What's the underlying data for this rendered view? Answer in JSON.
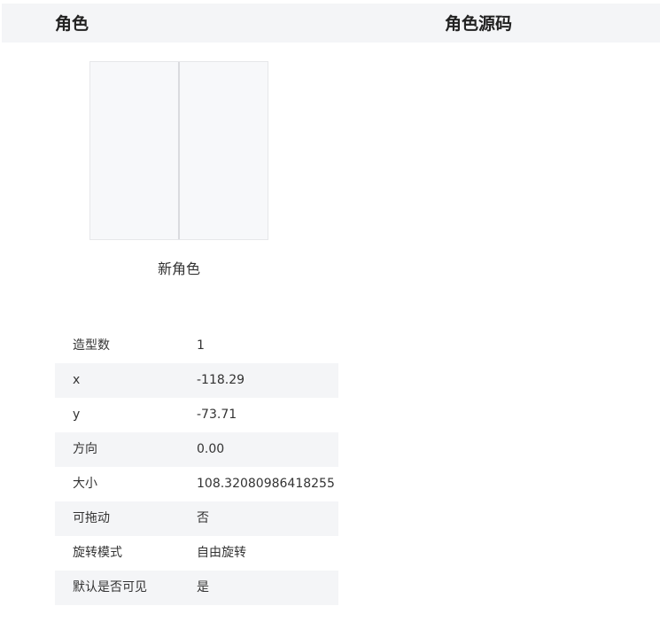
{
  "header": {
    "left_title": "角色",
    "right_title": "角色源码"
  },
  "sprite": {
    "name": "新角色"
  },
  "properties": [
    {
      "key": "造型数",
      "value": "1"
    },
    {
      "key": "x",
      "value": "-118.29"
    },
    {
      "key": "y",
      "value": "-73.71"
    },
    {
      "key": "方向",
      "value": "0.00"
    },
    {
      "key": "大小",
      "value": "108.32080986418255"
    },
    {
      "key": "可拖动",
      "value": "否"
    },
    {
      "key": "旋转模式",
      "value": "自由旋转"
    },
    {
      "key": "默认是否可见",
      "value": "是"
    }
  ]
}
